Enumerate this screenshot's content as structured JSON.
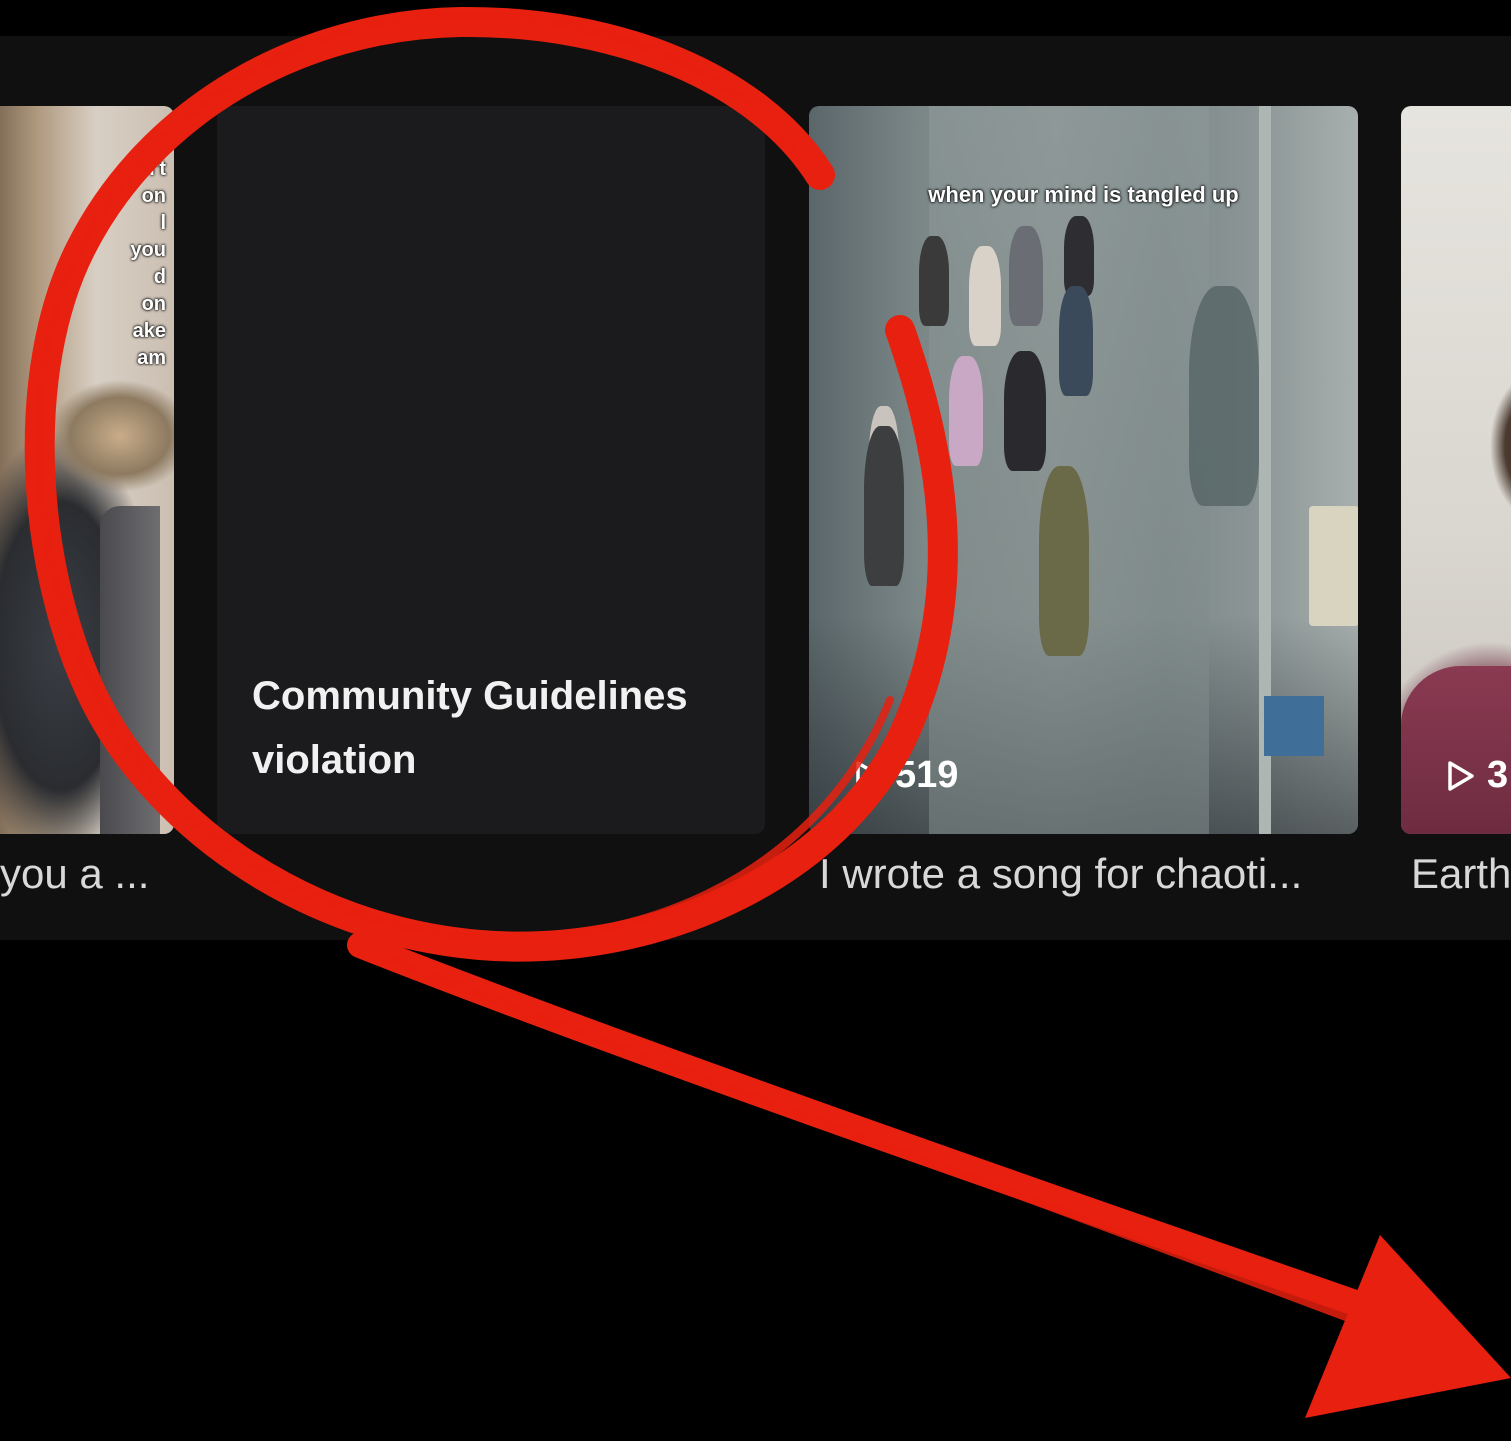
{
  "cards": [
    {
      "overlay_lines": [
        "n't",
        "on",
        "l",
        "you",
        "d",
        "on",
        "ake",
        "am"
      ],
      "caption": "you a ..."
    },
    {
      "violation_text": "Community Guidelines violation",
      "caption": ""
    },
    {
      "overlay_text": "when your mind is tangled up",
      "views": "519",
      "caption": "I wrote a song for chaoti..."
    },
    {
      "views": "3",
      "caption": "Earth"
    }
  ],
  "icons": {
    "play": "play-outline-icon"
  },
  "colors": {
    "annotation": "#e8200f",
    "panel_background": "#101010",
    "card_background": "#1b1b1d"
  }
}
